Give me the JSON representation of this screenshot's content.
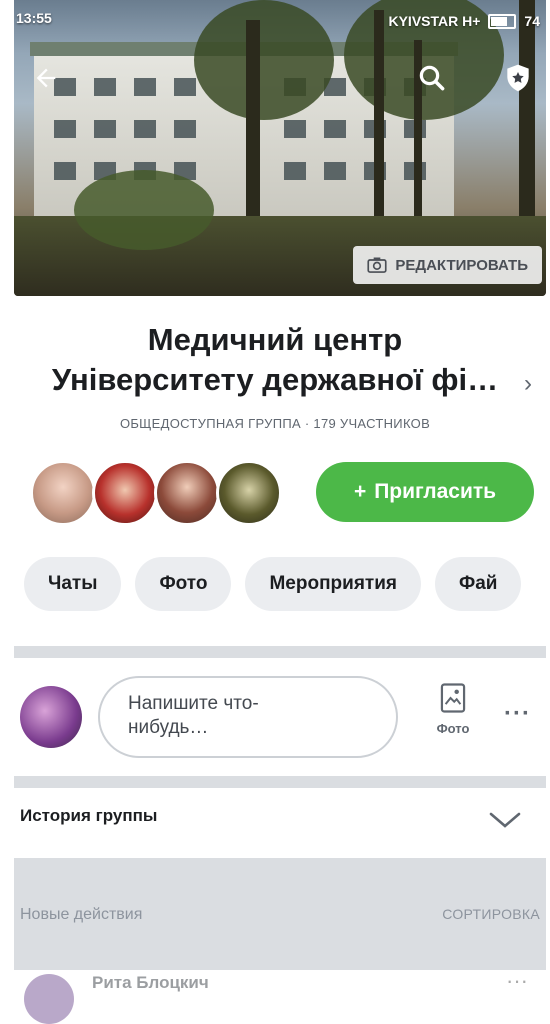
{
  "status_bar": {
    "time": "13:55",
    "carrier": "KYIVSTAR H+",
    "battery": "74"
  },
  "cover": {
    "edit_label": "РЕДАКТИРОВАТЬ"
  },
  "group": {
    "title_line1": "Медичний центр",
    "title_line2": "Університету державної фі…",
    "subtitle": "ОБЩЕДОСТУПНАЯ ГРУППА · 179 УЧАСТНИКОВ"
  },
  "invite": {
    "label": "Пригласить",
    "plus": "+"
  },
  "tabs": [
    "Чаты",
    "Фото",
    "Мероприятия",
    "Фай"
  ],
  "composer": {
    "placeholder_line1": "Напишите что-",
    "placeholder_line2": "нибудь…",
    "photo_label": "Фото",
    "more": "···"
  },
  "history": {
    "label": "История группы"
  },
  "activity": {
    "label": "Новые действия",
    "sort_label": "СОРТИРОВКА"
  },
  "post": {
    "author": "Рита Блоцкич",
    "more": "···"
  },
  "colors": {
    "accent_green": "#4cb848",
    "divider": "#dadde1",
    "chip_bg": "#ebedf0"
  },
  "icons": [
    "back-arrow-icon",
    "search-icon",
    "shield-star-icon",
    "camera-icon",
    "photo-icon",
    "more-icon",
    "chevron-down-icon",
    "chevron-right-icon"
  ]
}
